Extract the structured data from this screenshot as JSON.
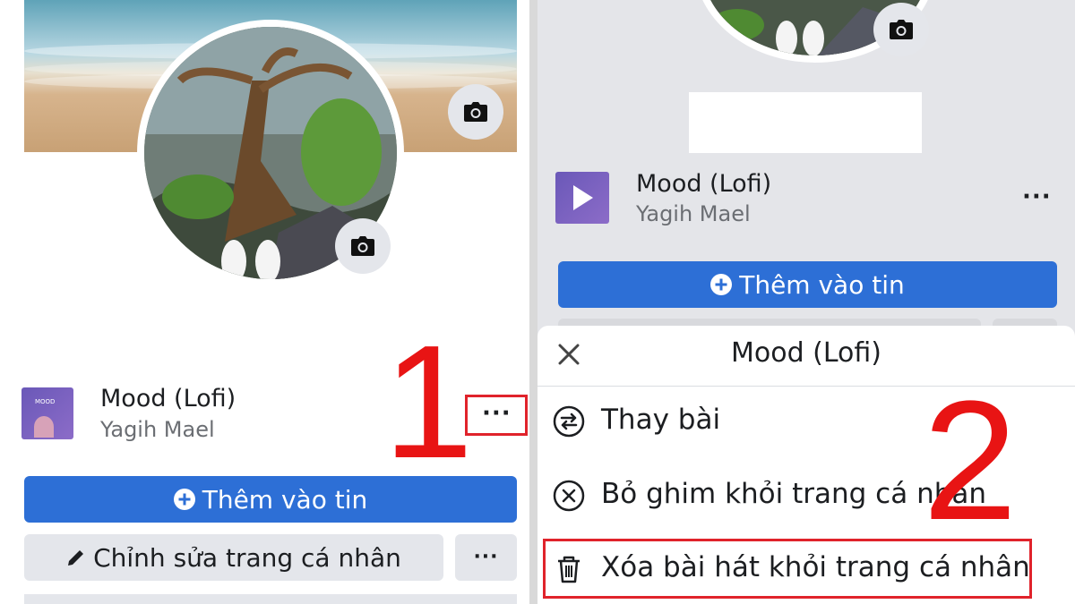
{
  "left": {
    "song": {
      "title": "Mood (Lofi)",
      "artist": "Yagih Mael",
      "thumb_label": "MOOD"
    },
    "add_story_label": "Thêm vào tin",
    "edit_profile_label": "Chỉnh sửa trang cá nhân",
    "more_label": "···",
    "song_more_label": "···",
    "step_number": "1"
  },
  "right": {
    "song": {
      "title": "Mood (Lofi)",
      "artist": "Yagih Mael"
    },
    "song_more_label": "···",
    "add_story_label": "Thêm vào tin",
    "sheet": {
      "title": "Mood (Lofi)",
      "items": [
        {
          "label": "Thay bài",
          "icon": "swap-icon"
        },
        {
          "label": "Bỏ ghim khỏi trang cá nhân",
          "icon": "circle-x-icon"
        },
        {
          "label": "Xóa bài hát khỏi trang cá nhân",
          "icon": "trash-icon"
        }
      ]
    },
    "step_number": "2"
  },
  "colors": {
    "primary_button": "#2d6fd6",
    "secondary_button": "#e4e6eb",
    "highlight": "#e0232b",
    "step_number": "#e81414"
  }
}
